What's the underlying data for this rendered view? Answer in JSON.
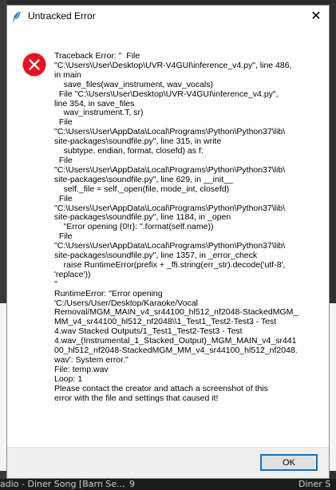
{
  "window": {
    "title": "Untracked Error",
    "close_glyph": "✕"
  },
  "error": {
    "icon": "error-icon",
    "message": "Traceback Error: \"  File\n\"C:\\Users\\User\\Desktop\\UVR-V4GUI\\inference_v4.py\", line 486,\nin main\n    save_files(wav_instrument, wav_vocals)\n  File \"C:\\Users\\User\\Desktop\\UVR-V4GUI\\inference_v4.py\",\nline 354, in save_files\n    wav_instrument.T, sr)\n  File\n\"C:\\Users\\User\\AppData\\Local\\Programs\\Python\\Python37\\lib\\\nsite-packages\\soundfile.py\", line 315, in write\n    subtype, endian, format, closefd) as f:\n  File\n\"C:\\Users\\User\\AppData\\Local\\Programs\\Python\\Python37\\lib\\\nsite-packages\\soundfile.py\", line 629, in __init__\n    self._file = self._open(file, mode_int, closefd)\n  File\n\"C:\\Users\\User\\AppData\\Local\\Programs\\Python\\Python37\\lib\\\nsite-packages\\soundfile.py\", line 1184, in _open\n    \"Error opening {0!r}: \".format(self.name))\n  File\n\"C:\\Users\\User\\AppData\\Local\\Programs\\Python\\Python37\\lib\\\nsite-packages\\soundfile.py\", line 1357, in _error_check\n    raise RuntimeError(prefix + _ffi.string(err_str).decode('utf-8',\n'replace'))\n\"\nRuntimeError: \"Error opening\n'C:/Users/User/Desktop/Karaoke/Vocal\nRemoval/MGM_MAIN_v4_sr44100_hl512_nf2048-StackedMGM_\nMM_v4_sr44100_hl512_nf2048\\\\1_Test1_Test2-Test3 - Test\n4.wav Stacked Outputs/1_Test1_Test2-Test3 - Test\n4.wav_(Instrumental_1_Stacked_Output)_MGM_MAIN_v4_sr441\n00_hl512_nf2048-StackedMGM_MM_v4_sr44100_hl512_nf2048.\nwav': System error.\"\nFile: temp.wav\nLoop: 1\nPlease contact the creator and attach a screenshot of this\nerror with the file and settings that caused it!"
  },
  "buttons": {
    "ok_label": "OK"
  },
  "background": {
    "track_text": "adio - Diner Song [Barn Se...",
    "track_number": "9",
    "track_text_2": "Diner S"
  },
  "colors": {
    "error_red": "#e81123",
    "focus_blue": "#0078d7"
  }
}
